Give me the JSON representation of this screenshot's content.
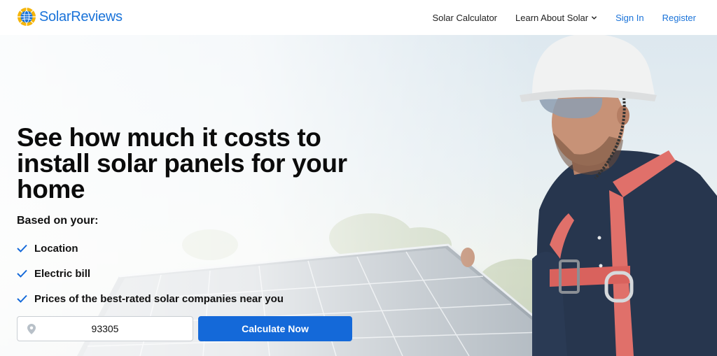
{
  "brand": {
    "name": "SolarReviews",
    "color": "#1a73d9",
    "icon": "sun-globe-icon"
  },
  "nav": {
    "solar_calculator": "Solar Calculator",
    "learn_about_solar": "Learn About Solar",
    "sign_in": "Sign In",
    "register": "Register"
  },
  "hero": {
    "headline": "See how much it costs to install solar panels for your home",
    "based_on": "Based on your:",
    "checklist": [
      "Location",
      "Electric bill",
      "Prices of the best-rated solar companies near you"
    ],
    "zip_value": "93305",
    "zip_icon": "location-pin-icon",
    "cta_label": "Calculate Now",
    "accent_color": "#1469d9"
  }
}
